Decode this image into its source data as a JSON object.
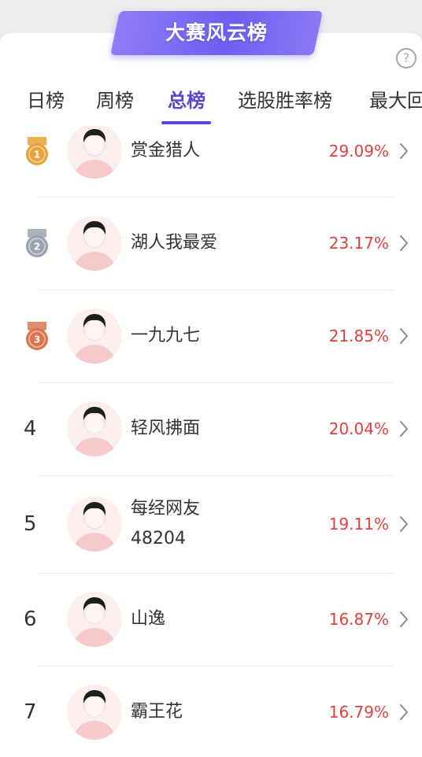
{
  "header": {
    "title": "大赛风云榜",
    "help_glyph": "?"
  },
  "tabs": [
    {
      "label": "日榜",
      "active": false
    },
    {
      "label": "周榜",
      "active": false
    },
    {
      "label": "总榜",
      "active": true
    },
    {
      "label": "选股胜率榜",
      "active": false
    },
    {
      "label": "最大回",
      "active": false
    }
  ],
  "colors": {
    "accent": "#5b45d6",
    "rate": "#e2403c",
    "gold": "#e8a23a",
    "silver": "#9aa3b0",
    "bronze": "#d9764d"
  },
  "rows": [
    {
      "rank": "1",
      "medal": "gold",
      "name": "赏金猎人",
      "rate": "29.09%"
    },
    {
      "rank": "2",
      "medal": "silver",
      "name": "湖人我最爱",
      "rate": "23.17%"
    },
    {
      "rank": "3",
      "medal": "bronze",
      "name": "一九九七",
      "rate": "21.85%"
    },
    {
      "rank": "4",
      "medal": null,
      "name": "轻风拂面",
      "rate": "20.04%"
    },
    {
      "rank": "5",
      "medal": null,
      "name": "每经网友",
      "name2": "48204",
      "rate": "19.11%"
    },
    {
      "rank": "6",
      "medal": null,
      "name": "山逸",
      "rate": "16.87%"
    },
    {
      "rank": "7",
      "medal": null,
      "name": "霸王花",
      "rate": "16.79%"
    }
  ]
}
